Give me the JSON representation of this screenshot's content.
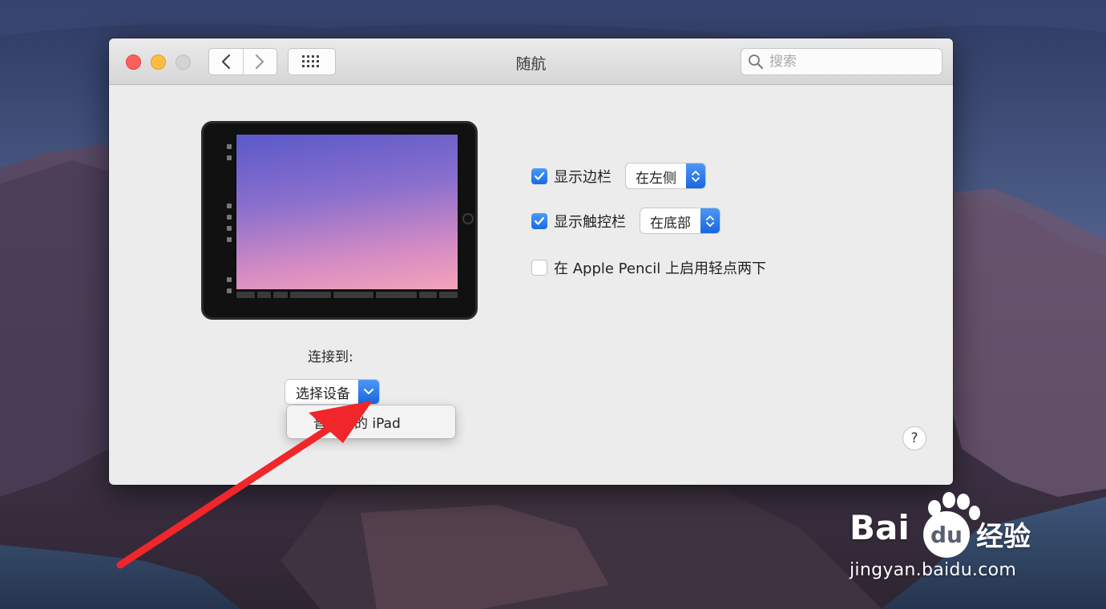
{
  "window": {
    "title": "随航"
  },
  "toolbar": {
    "back_label": "back",
    "forward_label": "forward",
    "show_all_label": "show all"
  },
  "search": {
    "placeholder": "搜索"
  },
  "options": {
    "sidebar": {
      "label": "显示边栏",
      "checked": true,
      "value": "在左侧"
    },
    "touchbar": {
      "label": "显示触控栏",
      "checked": true,
      "value": "在底部"
    },
    "pencil": {
      "label": "在 Apple Pencil 上启用轻点两下",
      "checked": false
    }
  },
  "connect": {
    "label": "连接到:",
    "selected": "选择设备",
    "menu_items": [
      "普家庭的 iPad"
    ]
  },
  "help": {
    "label": "?"
  },
  "watermark": {
    "brand": "Bai",
    "brand_du": "du",
    "jingyan": "经验",
    "url": "jingyan.baidu.com"
  },
  "colors": {
    "accent": "#1a6ae0",
    "annotation_arrow": "#f0262b"
  }
}
